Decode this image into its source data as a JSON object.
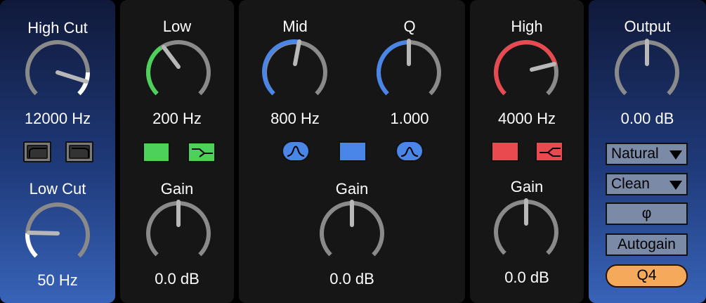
{
  "high_cut": {
    "title": "High Cut",
    "value": "12000 Hz",
    "accent": "#ffffff"
  },
  "low_cut": {
    "title": "Low Cut",
    "value": "50 Hz",
    "accent": "#ffffff"
  },
  "low": {
    "title": "Low",
    "freq": "200 Hz",
    "gain_title": "Gain",
    "gain": "0.0 dB",
    "color": "#4dd15a"
  },
  "mid": {
    "title": "Mid",
    "freq": "800 Hz",
    "q_title": "Q",
    "q_value": "1.000",
    "gain_title": "Gain",
    "gain": "0.0 dB",
    "color": "#4a86e8"
  },
  "high": {
    "title": "High",
    "freq": "4000 Hz",
    "gain_title": "Gain",
    "gain": "0.0 dB",
    "color": "#e84a4f"
  },
  "output": {
    "title": "Output",
    "value": "0.00 dB"
  },
  "controls": {
    "mode_dropdown": "Natural",
    "quality_dropdown": "Clean",
    "phase_symbol": "φ",
    "autogain": "Autogain",
    "q4": "Q4",
    "q4_color": "#f5a95a"
  },
  "icons": [
    "lowpass-filter-icon",
    "highpass-filter-icon",
    "low-shelf-icon",
    "bell-filter-icon",
    "high-shelf-icon"
  ]
}
